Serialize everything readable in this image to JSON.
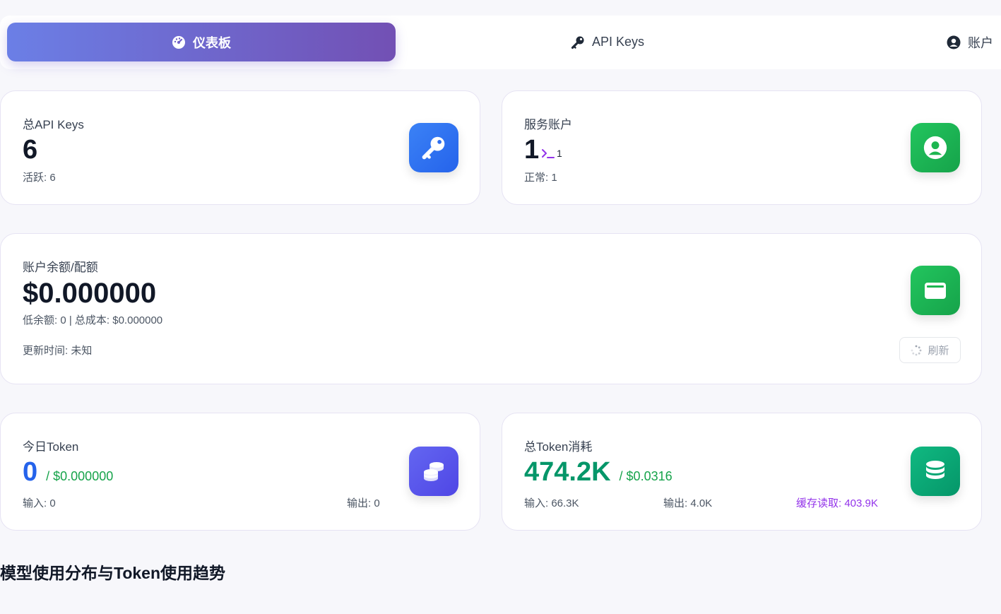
{
  "tabs": [
    {
      "label": "仪表板",
      "icon": "gauge-icon",
      "active": true
    },
    {
      "label": "API Keys",
      "icon": "key-icon",
      "active": false
    },
    {
      "label": "账户",
      "icon": "user-circle-icon",
      "active": false
    }
  ],
  "stats": {
    "api_keys": {
      "label": "总API Keys",
      "value": "6",
      "sub": "活跃: 6",
      "icon": "key-icon"
    },
    "service_accounts": {
      "label": "服务账户",
      "value": "1",
      "badge_count": "1",
      "badge_icon": "terminal-icon",
      "sub": "正常: 1",
      "icon": "user-circle-icon"
    },
    "balance": {
      "label": "账户余额/配额",
      "value": "$0.000000",
      "sub": "低余额: 0 | 总成本: $0.000000",
      "updated": "更新时间: 未知",
      "refresh_label": "刷新",
      "icon": "wallet-icon"
    },
    "today_token": {
      "label": "今日Token",
      "value": "0",
      "cost": "/ $0.000000",
      "input": "输入: 0",
      "output": "输出: 0",
      "icon": "coins-icon"
    },
    "total_token": {
      "label": "总Token消耗",
      "value": "474.2K",
      "cost": "/ $0.0316",
      "input": "输入: 66.3K",
      "output": "输出: 4.0K",
      "cache": "缓存读取: 403.9K",
      "icon": "database-icon"
    }
  },
  "section_title": "模型使用分布与Token使用趋势",
  "colors": {
    "accent_start": "#6b7fe6",
    "accent_end": "#7250b4",
    "blue": "#2563eb",
    "green": "#16a34a",
    "emerald": "#059669",
    "purple": "#9333ea"
  }
}
